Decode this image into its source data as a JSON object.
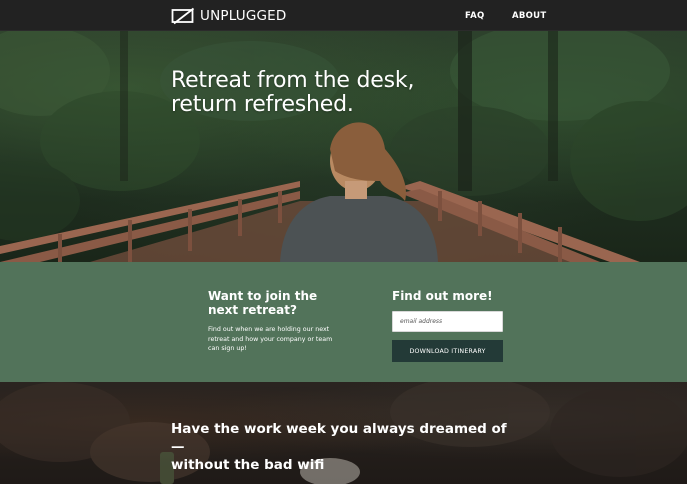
{
  "brand": {
    "name": "UNPLUGGED",
    "icon": "unplugged-logo-icon"
  },
  "nav": {
    "items": [
      {
        "label": "FAQ"
      },
      {
        "label": "ABOUT"
      }
    ]
  },
  "hero": {
    "title_line1": "Retreat from the desk,",
    "title_line2": "return refreshed."
  },
  "signup": {
    "join_title_line1": "Want to join the",
    "join_title_line2": "next retreat?",
    "join_text": "Find out when we are holding our next retreat and how your company or team can sign up!",
    "find_title": "Find out more!",
    "email_placeholder": "email address",
    "download_label": "DOWNLOAD ITINERARY"
  },
  "feature": {
    "title_line1": "Have the work week you always dreamed of —",
    "title_line2": "without the bad wifi"
  },
  "colors": {
    "topbar": "#222222",
    "band": "#52735a",
    "button": "#233a37"
  }
}
